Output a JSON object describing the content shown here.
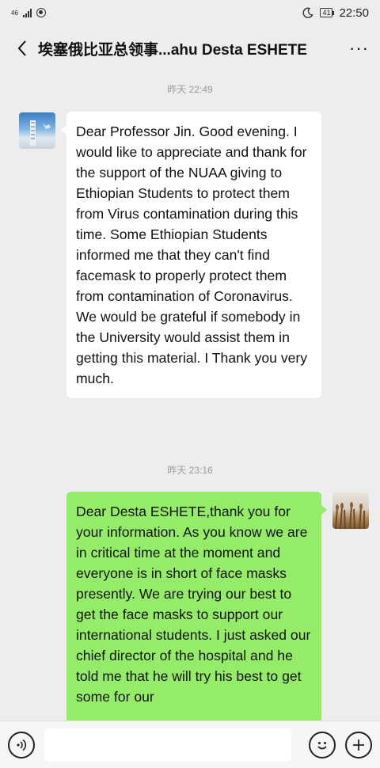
{
  "status_bar": {
    "network": "46",
    "battery": "41",
    "time": "22:50",
    "icons": [
      "signal-icon",
      "hotspot-icon",
      "moon-icon",
      "battery-icon"
    ]
  },
  "header": {
    "title": "埃塞俄比亚总领事...ahu Desta ESHETE",
    "back_icon": "chevron-left-icon",
    "more_label": "···"
  },
  "messages": [
    {
      "timestamp": "昨天 22:49",
      "direction": "incoming",
      "text": "Dear Professor Jin. Good evening. I would like to appreciate and thank for the support of the NUAA giving to  Ethiopian Students to protect them from Virus contamination during this time. Some Ethiopian Students informed me that they can't find  facemask to properly protect them from contamination of Coronavirus. We would be grateful if somebody in the University would assist them in getting this material. I Thank you very much."
    },
    {
      "timestamp": "昨天 23:16",
      "direction": "outgoing",
      "text": "Dear Desta ESHETE,thank you for your information.  As you know we are in critical time at the moment and everyone is in short of face masks presently. We are trying our best to get the face masks to support our international students. I just asked our chief  director of the hospital and he told me that he will try his best to get some for our"
    }
  ],
  "input_bar": {
    "voice_icon": "voice-icon",
    "emoji_icon": "emoji-icon",
    "plus_icon": "plus-icon",
    "colors": {
      "outgoing_bubble": "#95ec69",
      "incoming_bubble": "#ffffff",
      "background": "#ededed"
    }
  }
}
